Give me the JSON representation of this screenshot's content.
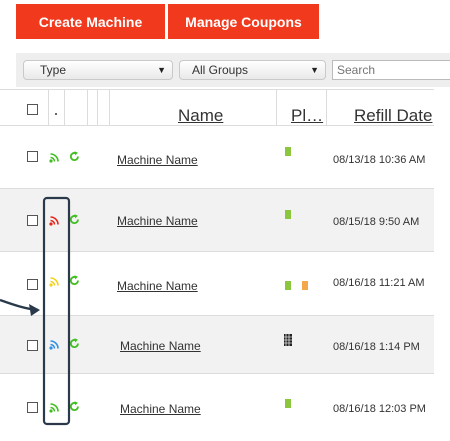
{
  "toolbar": {
    "create_label": "Create Machine",
    "coupons_label": "Manage Coupons",
    "type_filter": "Type",
    "group_filter": "All Groups",
    "search_placeholder": "Search"
  },
  "table": {
    "columns": {
      "name": "Name",
      "pl": "Pl…",
      "refill": "Refill Date"
    },
    "rows": [
      {
        "name": "Machine Name",
        "refill": "08/13/18 10:36 AM",
        "signal": "green",
        "planogram": [
          "green"
        ]
      },
      {
        "name": "Machine Name",
        "refill": "08/15/18 9:50 AM",
        "signal": "red",
        "planogram": [
          "green"
        ]
      },
      {
        "name": "Machine Name",
        "refill": "08/16/18 11:21 AM",
        "signal": "yellow",
        "planogram": [
          "green",
          "orange"
        ]
      },
      {
        "name": "Machine Name",
        "refill": "08/16/18 1:14 PM",
        "signal": "blue",
        "planogram": [
          "barcode"
        ]
      },
      {
        "name": "Machine Name",
        "refill": "08/16/18 12:03 PM",
        "signal": "green",
        "planogram": [
          "green"
        ]
      }
    ]
  },
  "colors": {
    "accent": "#f0391d",
    "signal_green": "#3fbf1f",
    "signal_red": "#e8251b",
    "signal_yellow": "#f2d21b",
    "signal_blue": "#2e90e6",
    "status_green": "#3fbf1f",
    "planogram_green": "#8cc63f",
    "planogram_orange": "#f5a84a",
    "annotation": "#2b3a4a"
  },
  "icons": [
    "wifi-signal-icon",
    "refresh-status-icon",
    "chevron-down-icon",
    "barcode-icon"
  ]
}
